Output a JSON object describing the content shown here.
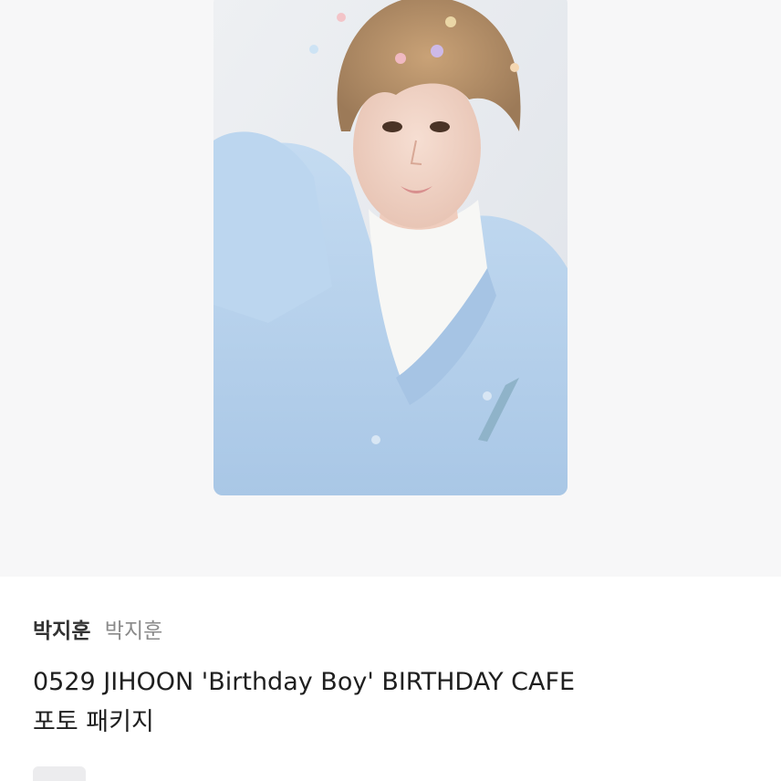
{
  "product": {
    "image": {
      "alt": "photocard"
    },
    "artist_name": "박지훈",
    "artist_tag": "박지훈",
    "title_line1": "0529 JIHOON 'Birthday Boy' BIRTHDAY CAFE",
    "title_line2": "포토 패키지"
  },
  "colors": {
    "hero_background": "#f7f7f8",
    "sweater": "#b8d2ec",
    "text_primary": "#1f1f1f",
    "text_secondary": "#8a8a8a"
  }
}
